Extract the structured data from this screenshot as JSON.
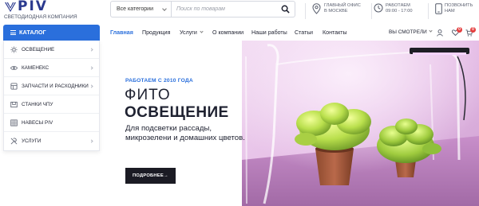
{
  "header": {
    "logo": {
      "brand": "PIV",
      "tagline": "СВЕТОДИОДНАЯ КОМПАНИЯ"
    },
    "search": {
      "category_label": "Все категории",
      "placeholder": "Поиск по товарам",
      "value": ""
    },
    "office": {
      "line1": "ГЛАВНЫЙ ОФИС",
      "line2": "В МОСКВЕ"
    },
    "hours": {
      "line1": "РАБОТАЕМ",
      "line2": "09:00 - 17:00"
    },
    "call": {
      "line1": "ПОЗВОНИТЬ",
      "line2": "НАМ"
    }
  },
  "catalog": {
    "label": "КАТАЛОГ"
  },
  "nav": {
    "items": [
      {
        "label": "Главная"
      },
      {
        "label": "Продукция"
      },
      {
        "label": "Услуги"
      },
      {
        "label": "О компании"
      },
      {
        "label": "Наши работы"
      },
      {
        "label": "Статьи"
      },
      {
        "label": "Контакты"
      }
    ],
    "viewed_label": "ВЫ СМОТРЕЛИ",
    "favorites_count": "0",
    "cart_count": "0"
  },
  "sidebar": {
    "items": [
      {
        "label": "ОСВЕЩЕНИЕ",
        "icon": "lamp-icon"
      },
      {
        "label": "КАМЕНЕКС",
        "icon": "eye-icon"
      },
      {
        "label": "ЗАПЧАСТИ И РАСХОДНИКИ",
        "icon": "parts-icon"
      },
      {
        "label": "СТАНКИ ЧПУ",
        "icon": "cnc-icon"
      },
      {
        "label": "НАВЕСЫ PIV",
        "icon": "canopy-icon"
      },
      {
        "label": "УСЛУГИ",
        "icon": "tools-icon"
      }
    ]
  },
  "hero": {
    "kicker": "РАБОТАЕМ С 2010 ГОДА",
    "title_light": "ФИТО",
    "title_bold": "ОСВЕЩЕНИЕ",
    "subtitle": "Для подсветки рассады, микрозелени и домашних цветов.",
    "cta": "ПОДРОБНЕЕ→"
  },
  "colors": {
    "accent": "#2a6fdc",
    "dark": "#1b1b24",
    "badge": "#e43d3d",
    "brand": "#2b3a8f"
  }
}
